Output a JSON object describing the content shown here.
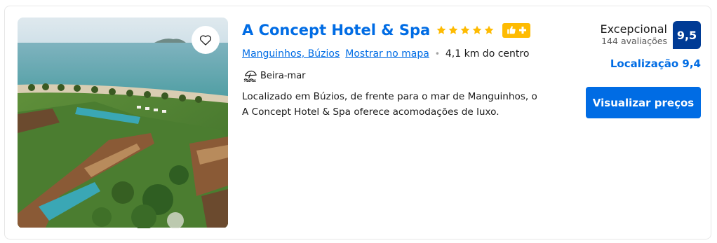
{
  "hotel": {
    "name": "A Concept Hotel & Spa",
    "stars": 5,
    "location_link": "Manguinhos, Búzios",
    "map_link": "Mostrar no mapa",
    "distance": "4,1 km do centro",
    "feature": "Beira-mar",
    "description": "Localizado em Búzios, de frente para o mar de Manguinhos, o A Concept Hotel & Spa oferece acomodações de luxo."
  },
  "review": {
    "score_word": "Excepcional",
    "review_count": "144 avaliações",
    "score": "9,5",
    "location_score": "Localização 9,4"
  },
  "actions": {
    "cta_label": "Visualizar preços"
  },
  "colors": {
    "brand_blue": "#006ce4",
    "score_blue": "#003b95",
    "star_yellow": "#febb02"
  },
  "icons": {
    "favorite": "heart-icon",
    "rating_star": "star-icon",
    "preferred_partner": "thumbs-up-plus-icon",
    "beachfront": "beach-umbrella-icon"
  }
}
